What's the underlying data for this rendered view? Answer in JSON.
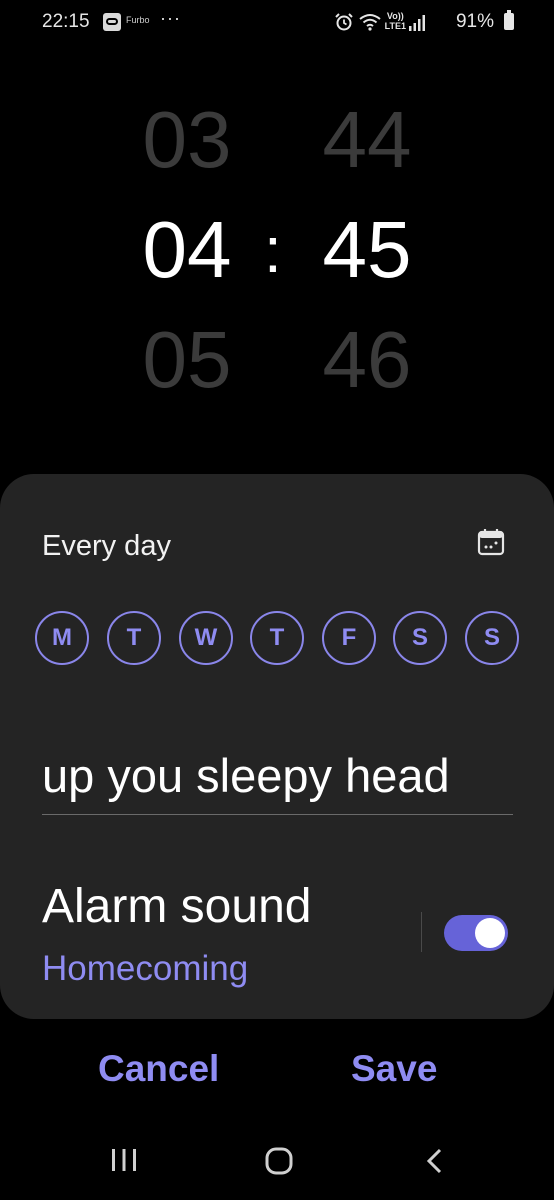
{
  "status_bar": {
    "time": "22:15",
    "app_label": "Furbo",
    "more": "···",
    "volte_top": "Vo))",
    "volte_bottom": "LTE1",
    "battery": "91%"
  },
  "time_picker": {
    "hours": {
      "prev": "03",
      "current": "04",
      "next": "05"
    },
    "separator": ":",
    "minutes": {
      "prev": "44",
      "current": "45",
      "next": "46"
    }
  },
  "repeat": {
    "label": "Every day",
    "days": [
      "M",
      "T",
      "W",
      "T",
      "F",
      "S",
      "S"
    ]
  },
  "alarm_name": {
    "value": "up you sleepy head"
  },
  "alarm_sound": {
    "title": "Alarm sound",
    "value": "Homecoming",
    "enabled": true
  },
  "actions": {
    "cancel": "Cancel",
    "save": "Save"
  },
  "colors": {
    "accent": "#8f8cf2",
    "toggle_on": "#6663d8",
    "card_bg": "#242424",
    "background": "#000000"
  }
}
